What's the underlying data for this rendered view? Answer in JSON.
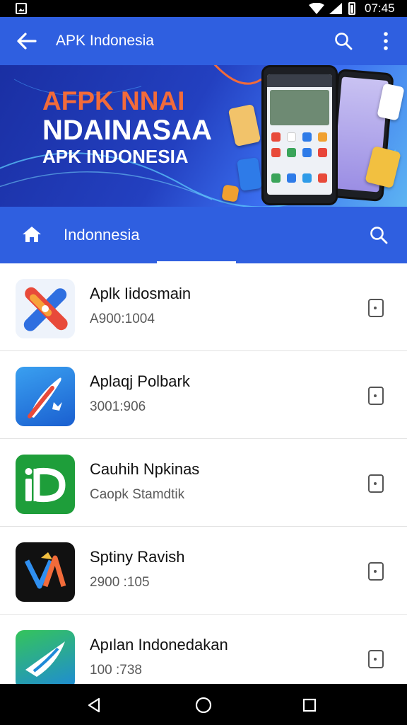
{
  "status_bar": {
    "time": "07:45"
  },
  "app_bar": {
    "title": "APK Indonesia"
  },
  "banner": {
    "line1": "AFPK NNAI",
    "line2": "NDAINASAA",
    "line3": "APK INDONESIA"
  },
  "sub_bar": {
    "title": "Indonnesia"
  },
  "apps": [
    {
      "title": "Aplk Iidosmain",
      "subtitle": "A900:1004"
    },
    {
      "title": "Aplaqj Polbark",
      "subtitle": "3001:906"
    },
    {
      "title": "Cauhih Npkinas",
      "subtitle": "Caopk Stamdtik"
    },
    {
      "title": "Sptiny Ravish",
      "subtitle": "2900 :105"
    },
    {
      "title": "Apılan Indonedakan",
      "subtitle": "100 :738"
    }
  ],
  "colors": {
    "primary": "#2f5fe0",
    "status_bar": "#000000",
    "banner_orange": "#f26b3a"
  }
}
